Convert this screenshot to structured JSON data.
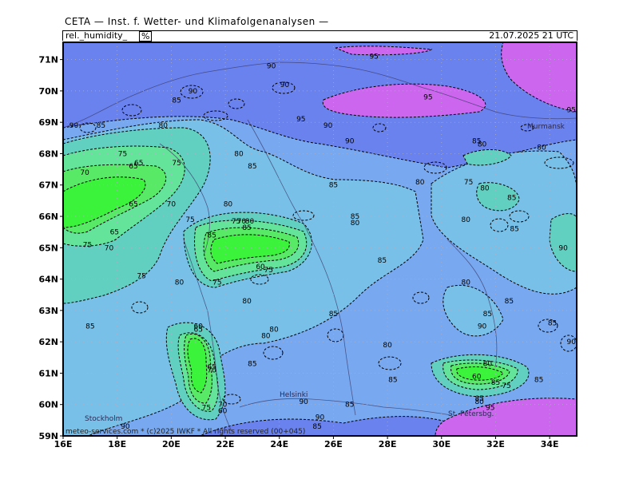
{
  "header": {
    "title": "CETA — Inst. f. Wetter- und Klimafolgenanalysen —",
    "parameter": "rel._humidity_",
    "unit": "%",
    "datetime": "21.07.2025 21 UTC"
  },
  "axes": {
    "lat_labels": [
      "71N",
      "70N",
      "69N",
      "68N",
      "67N",
      "66N",
      "65N",
      "64N",
      "63N",
      "62N",
      "61N",
      "60N",
      "59N"
    ],
    "lon_labels": [
      "16E",
      "18E",
      "20E",
      "22E",
      "24E",
      "26E",
      "28E",
      "30E",
      "32E",
      "34E"
    ]
  },
  "places": {
    "murmansk": "Murmansk",
    "helsinki": "Helsinki",
    "stockholm": "Stockholm",
    "st_petersburg": "St. Petersbg."
  },
  "footer": "meteo-services.com  * (c)2025 IWKF * All rights reserved (00+045)",
  "colors": {
    "h95": "#cc66ee",
    "h90": "#6a82ee",
    "h85": "#77a8f0",
    "h80": "#78c0e8",
    "h75": "#62d0c0",
    "h70": "#64e39a",
    "h65": "#58ea66",
    "h60": "#3af33a"
  },
  "contour_labels": [
    {
      "text": "95",
      "lon": 27.5,
      "lat": 71.1
    },
    {
      "text": "95",
      "lon": 29.5,
      "lat": 69.8
    },
    {
      "text": "95",
      "lon": 34.8,
      "lat": 69.4
    },
    {
      "text": "95",
      "lon": 24.8,
      "lat": 69.1
    },
    {
      "text": "90",
      "lon": 23.7,
      "lat": 70.8
    },
    {
      "text": "90",
      "lon": 24.2,
      "lat": 70.2
    },
    {
      "text": "90",
      "lon": 20.8,
      "lat": 70.0
    },
    {
      "text": "85",
      "lon": 20.2,
      "lat": 69.7
    },
    {
      "text": "90",
      "lon": 16.4,
      "lat": 68.9
    },
    {
      "text": "85",
      "lon": 17.4,
      "lat": 68.9
    },
    {
      "text": "80",
      "lon": 19.7,
      "lat": 68.9
    },
    {
      "text": "90",
      "lon": 25.8,
      "lat": 68.9
    },
    {
      "text": "90",
      "lon": 26.6,
      "lat": 68.4
    },
    {
      "text": "80",
      "lon": 22.5,
      "lat": 68.0
    },
    {
      "text": "85",
      "lon": 23.0,
      "lat": 67.6
    },
    {
      "text": "75",
      "lon": 18.2,
      "lat": 68.0
    },
    {
      "text": "75",
      "lon": 20.2,
      "lat": 67.7
    },
    {
      "text": "65",
      "lon": 18.6,
      "lat": 67.6
    },
    {
      "text": "65",
      "lon": 18.8,
      "lat": 67.7
    },
    {
      "text": "70",
      "lon": 16.8,
      "lat": 67.4
    },
    {
      "text": "65",
      "lon": 18.6,
      "lat": 66.4
    },
    {
      "text": "70",
      "lon": 20.0,
      "lat": 66.4
    },
    {
      "text": "80",
      "lon": 22.1,
      "lat": 66.4
    },
    {
      "text": "75",
      "lon": 20.7,
      "lat": 65.9
    },
    {
      "text": "75",
      "lon": 22.4,
      "lat": 65.85
    },
    {
      "text": "70",
      "lon": 22.6,
      "lat": 65.85
    },
    {
      "text": "80",
      "lon": 22.9,
      "lat": 65.85
    },
    {
      "text": "85",
      "lon": 22.8,
      "lat": 65.65
    },
    {
      "text": "85",
      "lon": 21.5,
      "lat": 65.4
    },
    {
      "text": "65",
      "lon": 17.9,
      "lat": 65.5
    },
    {
      "text": "75",
      "lon": 16.9,
      "lat": 65.1
    },
    {
      "text": "70",
      "lon": 17.7,
      "lat": 65.0
    },
    {
      "text": "75",
      "lon": 18.9,
      "lat": 64.1
    },
    {
      "text": "80",
      "lon": 20.3,
      "lat": 63.9
    },
    {
      "text": "75",
      "lon": 21.7,
      "lat": 63.9
    },
    {
      "text": "60",
      "lon": 23.3,
      "lat": 64.4
    },
    {
      "text": "75",
      "lon": 23.6,
      "lat": 64.3
    },
    {
      "text": "85",
      "lon": 26.8,
      "lat": 66.0
    },
    {
      "text": "80",
      "lon": 26.8,
      "lat": 65.8
    },
    {
      "text": "85",
      "lon": 27.8,
      "lat": 64.6
    },
    {
      "text": "85",
      "lon": 26.0,
      "lat": 67.0
    },
    {
      "text": "80",
      "lon": 29.2,
      "lat": 67.1
    },
    {
      "text": "75",
      "lon": 31.0,
      "lat": 67.1
    },
    {
      "text": "80",
      "lon": 31.6,
      "lat": 66.9
    },
    {
      "text": "85",
      "lon": 32.6,
      "lat": 66.6
    },
    {
      "text": "80",
      "lon": 30.9,
      "lat": 65.9
    },
    {
      "text": "85",
      "lon": 32.7,
      "lat": 65.6
    },
    {
      "text": "85",
      "lon": 31.3,
      "lat": 68.4
    },
    {
      "text": "80",
      "lon": 31.5,
      "lat": 68.3
    },
    {
      "text": "80",
      "lon": 33.7,
      "lat": 68.2
    },
    {
      "text": "90",
      "lon": 34.5,
      "lat": 65.0
    },
    {
      "text": "80",
      "lon": 30.9,
      "lat": 63.9
    },
    {
      "text": "85",
      "lon": 32.5,
      "lat": 63.3
    },
    {
      "text": "85",
      "lon": 31.7,
      "lat": 62.9
    },
    {
      "text": "90",
      "lon": 31.5,
      "lat": 62.5
    },
    {
      "text": "85",
      "lon": 34.1,
      "lat": 62.6
    },
    {
      "text": "85",
      "lon": 26.0,
      "lat": 62.9
    },
    {
      "text": "80",
      "lon": 22.8,
      "lat": 63.3
    },
    {
      "text": "80",
      "lon": 23.5,
      "lat": 62.2
    },
    {
      "text": "80",
      "lon": 23.8,
      "lat": 62.4
    },
    {
      "text": "80",
      "lon": 28.0,
      "lat": 61.9
    },
    {
      "text": "85",
      "lon": 23.0,
      "lat": 61.3
    },
    {
      "text": "85",
      "lon": 28.2,
      "lat": 60.8
    },
    {
      "text": "85",
      "lon": 17.0,
      "lat": 62.5
    },
    {
      "text": "60",
      "lon": 21.0,
      "lat": 62.5
    },
    {
      "text": "65",
      "lon": 21.0,
      "lat": 62.4
    },
    {
      "text": "65",
      "lon": 21.5,
      "lat": 61.2
    },
    {
      "text": "70",
      "lon": 21.5,
      "lat": 61.1
    },
    {
      "text": "75",
      "lon": 21.3,
      "lat": 59.9
    },
    {
      "text": "70",
      "lon": 21.9,
      "lat": 60.0
    },
    {
      "text": "60",
      "lon": 21.9,
      "lat": 59.8
    },
    {
      "text": "60",
      "lon": 31.3,
      "lat": 60.9
    },
    {
      "text": "80",
      "lon": 31.7,
      "lat": 61.3
    },
    {
      "text": "85",
      "lon": 32.0,
      "lat": 60.7
    },
    {
      "text": "75",
      "lon": 32.4,
      "lat": 60.6
    },
    {
      "text": "85",
      "lon": 33.6,
      "lat": 60.8
    },
    {
      "text": "85",
      "lon": 31.4,
      "lat": 60.2
    },
    {
      "text": "80",
      "lon": 31.4,
      "lat": 60.1
    },
    {
      "text": "95",
      "lon": 31.8,
      "lat": 59.9
    },
    {
      "text": "90",
      "lon": 25.5,
      "lat": 59.6
    },
    {
      "text": "85",
      "lon": 26.6,
      "lat": 60.0
    },
    {
      "text": "85",
      "lon": 25.4,
      "lat": 59.3
    },
    {
      "text": "90",
      "lon": 24.9,
      "lat": 60.1
    },
    {
      "text": "90",
      "lon": 18.3,
      "lat": 59.3
    },
    {
      "text": "90",
      "lon": 34.9,
      "lat": 63.7
    },
    {
      "text": "90",
      "lon": 34.8,
      "lat": 62.0
    }
  ]
}
